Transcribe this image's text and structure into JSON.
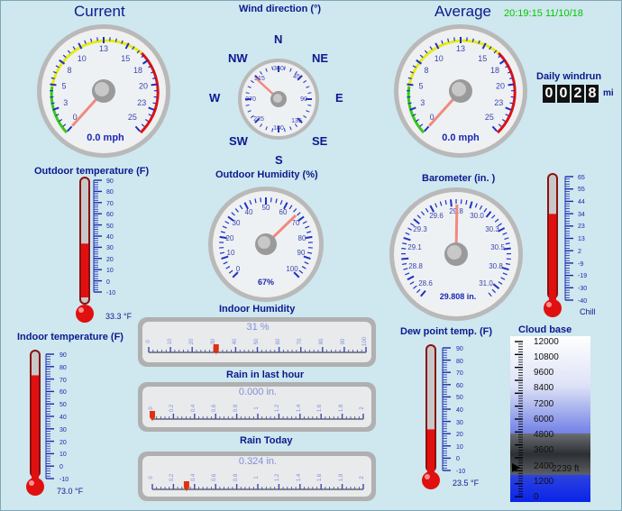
{
  "header": {
    "current_label": "Current",
    "wind_direction_label": "Wind direction (°)",
    "average_label": "Average",
    "timestamp": "20:19:15 11/10/18"
  },
  "wind_speed_gauge": {
    "scale": [
      "0",
      "3",
      "5",
      "8",
      "10",
      "13",
      "15",
      "18",
      "20",
      "23",
      "25"
    ],
    "current_readout": "0.0 mph",
    "average_readout": "0.0 mph",
    "current_value": 0.0,
    "average_value": 0.0
  },
  "wind_direction_gauge": {
    "compass": {
      "n": "N",
      "ne": "NE",
      "e": "E",
      "se": "SE",
      "s": "S",
      "sw": "SW",
      "w": "W",
      "nw": "NW"
    },
    "scale": [
      "360",
      "45",
      "90",
      "135",
      "180",
      "225",
      "270",
      "315"
    ]
  },
  "daily_windrun": {
    "label": "Daily windrun",
    "digits": [
      "0",
      "0",
      "2",
      "8"
    ],
    "unit": "mi"
  },
  "outdoor_temperature": {
    "label": "Outdoor temperature (F)",
    "scale": [
      "90",
      "80",
      "70",
      "60",
      "50",
      "40",
      "30",
      "20",
      "10",
      "0",
      "-10"
    ],
    "value": 33.3,
    "readout": "33.3 °F"
  },
  "outdoor_humidity": {
    "label": "Outdoor Humidity (%)",
    "scale": [
      "0",
      "10",
      "20",
      "30",
      "40",
      "50",
      "60",
      "70",
      "80",
      "90",
      "100"
    ],
    "value": 67,
    "readout": "67%"
  },
  "barometer": {
    "label": "Barometer (in. )",
    "scale": [
      "28.6",
      "28.8",
      "29.1",
      "29.3",
      "29.6",
      "29.8",
      "30.0",
      "30.3",
      "30.5",
      "30.8",
      "31.0"
    ],
    "value": 29.808,
    "readout": "29.808 in."
  },
  "wind_chill": {
    "scale": [
      "65",
      "55",
      "44",
      "34",
      "23",
      "13",
      "2",
      "-9",
      "-19",
      "-30",
      "-40"
    ],
    "label": "Chill",
    "value": 33.3
  },
  "indoor_humidity": {
    "label": "Indoor Humidity",
    "readout": "31 %",
    "scale": [
      "0",
      "10",
      "20",
      "30",
      "40",
      "50",
      "60",
      "70",
      "80",
      "90",
      "100"
    ],
    "value": 31
  },
  "rain_last_hour": {
    "label": "Rain in last hour",
    "readout": "0.000 in.",
    "scale": [
      "0",
      "0.2",
      "0.4",
      "0.6",
      "0.8",
      "1",
      "1.2",
      "1.4",
      "1.6",
      "1.8",
      "2"
    ],
    "value": 0.0
  },
  "rain_today": {
    "label": "Rain Today",
    "readout": "0.324 in.",
    "scale": [
      "0",
      "0.2",
      "0.4",
      "0.6",
      "0.8",
      "1",
      "1.2",
      "1.4",
      "1.6",
      "1.8",
      "2"
    ],
    "value": 0.324
  },
  "indoor_temperature": {
    "label": "Indoor temperature (F)",
    "scale": [
      "90",
      "80",
      "70",
      "60",
      "50",
      "40",
      "30",
      "20",
      "10",
      "0",
      "-10"
    ],
    "value": 73.0,
    "readout": "73.0 °F"
  },
  "dew_point": {
    "label": "Dew point temp. (F)",
    "scale": [
      "90",
      "80",
      "70",
      "60",
      "50",
      "40",
      "30",
      "20",
      "10",
      "0",
      "-10"
    ],
    "value": 23.5,
    "readout": "23.5 °F"
  },
  "cloud_base": {
    "label": "Cloud base",
    "scale": [
      "12000",
      "10800",
      "9600",
      "8400",
      "7200",
      "6000",
      "4800",
      "3600",
      "2400",
      "1200",
      "0"
    ],
    "value": 2239,
    "readout": "2239 ft"
  },
  "colors": {
    "label_blue": "#0a1a8f",
    "timestamp_green": "#00c800",
    "needle": "#f08a7e",
    "mercury": "#e01010",
    "background": "#cfe7ee"
  }
}
